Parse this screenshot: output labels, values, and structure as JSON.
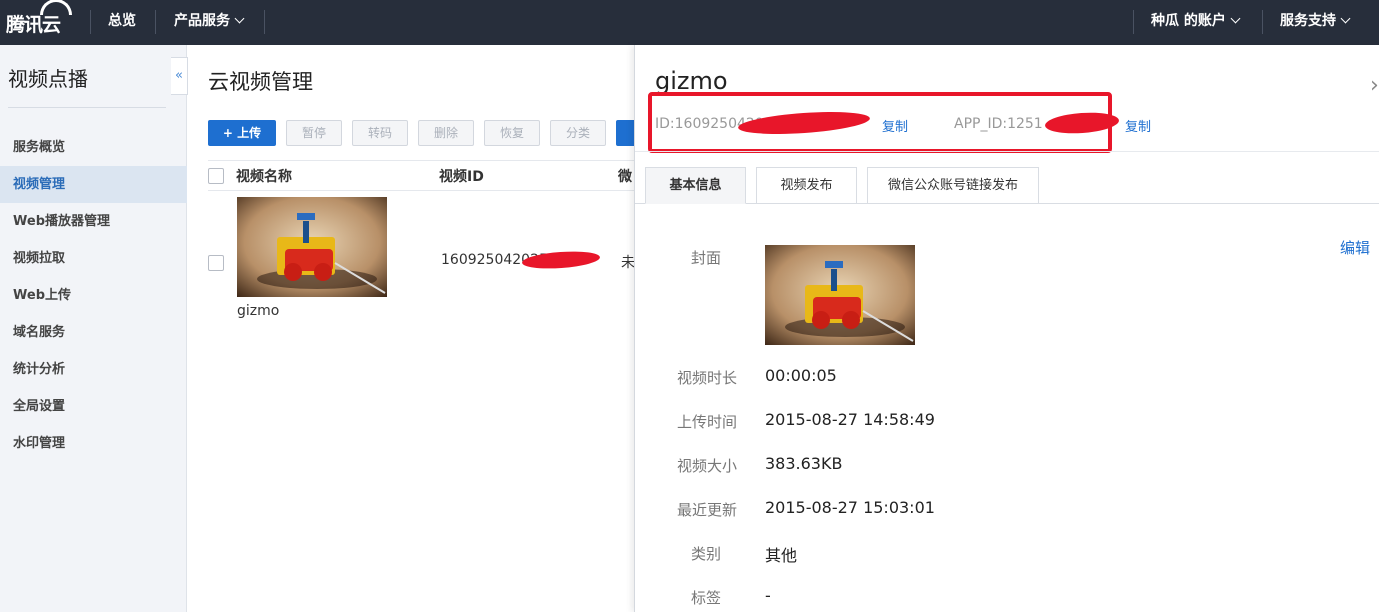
{
  "topbar": {
    "logo": "腾讯云",
    "nav": [
      "总览",
      "产品服务"
    ],
    "account": "种瓜 的账户",
    "support": "服务支持"
  },
  "sidebar": {
    "title": "视频点播",
    "collapse": "«",
    "items": [
      {
        "label": "服务概览",
        "active": false
      },
      {
        "label": "视频管理",
        "active": true
      },
      {
        "label": "Web播放器管理",
        "active": false
      },
      {
        "label": "视频拉取",
        "active": false
      },
      {
        "label": "Web上传",
        "active": false
      },
      {
        "label": "域名服务",
        "active": false
      },
      {
        "label": "统计分析",
        "active": false
      },
      {
        "label": "全局设置",
        "active": false
      },
      {
        "label": "水印管理",
        "active": false
      }
    ]
  },
  "main": {
    "title": "云视频管理",
    "toolbar": {
      "upload": "+ 上传",
      "pause": "暂停",
      "transcode": "转码",
      "delete": "删除",
      "restore": "恢复",
      "category": "分类"
    },
    "table": {
      "headers": {
        "name": "视频名称",
        "id": "视频ID",
        "wechat": "微"
      },
      "rows": [
        {
          "name": "gizmo",
          "id": "160925042025",
          "status": "未"
        }
      ]
    }
  },
  "panel": {
    "title": "gizmo",
    "close": "›",
    "id_text": "ID:1609250420",
    "app_id_text": "APP_ID:1251",
    "copy": "复制",
    "tabs": [
      {
        "label": "基本信息",
        "active": true
      },
      {
        "label": "视频发布",
        "active": false
      },
      {
        "label": "微信公众账号链接发布",
        "active": false
      }
    ],
    "edit": "编辑",
    "fields": {
      "cover": {
        "label": "封面"
      },
      "duration": {
        "label": "视频时长",
        "value": "00:00:05"
      },
      "upload_time": {
        "label": "上传时间",
        "value": "2015-08-27 14:58:49"
      },
      "size": {
        "label": "视频大小",
        "value": "383.63KB"
      },
      "updated": {
        "label": "最近更新",
        "value": "2015-08-27 15:03:01"
      },
      "category": {
        "label": "类别",
        "value": "其他"
      },
      "tags": {
        "label": "标签",
        "value": "-"
      }
    }
  },
  "colors": {
    "topbar": "#272e3b",
    "primary": "#1e6fd0",
    "highlight": "#e8162a"
  }
}
